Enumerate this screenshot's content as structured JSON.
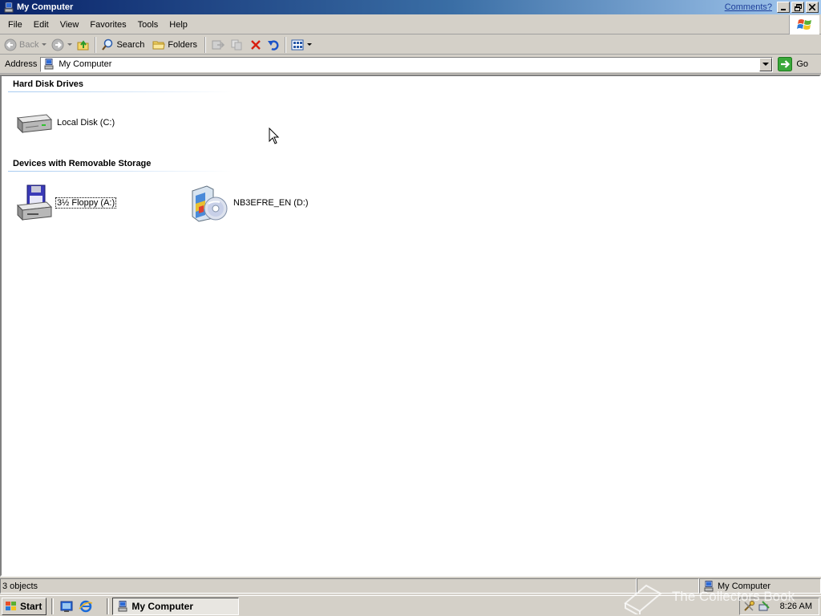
{
  "window": {
    "title": "My Computer",
    "comments_link": "Comments?"
  },
  "menu": [
    "File",
    "Edit",
    "View",
    "Favorites",
    "Tools",
    "Help"
  ],
  "toolbar": {
    "back_label": "Back",
    "search_label": "Search",
    "folders_label": "Folders"
  },
  "address": {
    "label": "Address",
    "value": "My Computer",
    "go_label": "Go"
  },
  "groups": {
    "hard_disk": {
      "title": "Hard Disk Drives",
      "items": [
        {
          "label": "Local Disk (C:)"
        }
      ]
    },
    "removable": {
      "title": "Devices with Removable Storage",
      "items": [
        {
          "label": "3½ Floppy (A:)"
        },
        {
          "label": "NB3EFRE_EN (D:)"
        }
      ]
    }
  },
  "statusbar": {
    "objects": "3 objects",
    "location": "My Computer"
  },
  "taskbar": {
    "start_label": "Start",
    "task_label": "My Computer",
    "clock": "8:26 AM"
  },
  "watermark": "The Collectors Book"
}
